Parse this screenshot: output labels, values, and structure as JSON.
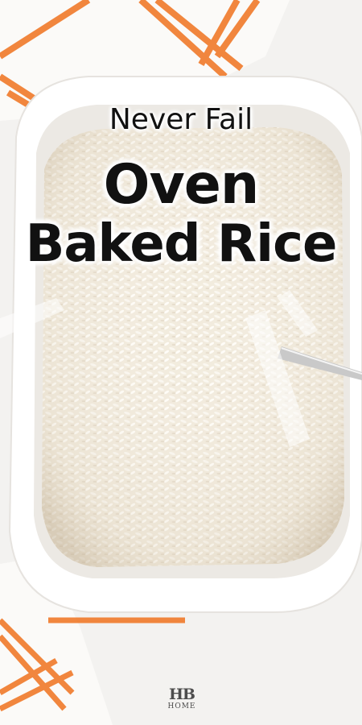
{
  "title": {
    "line1": "Never Fail",
    "line2": "Oven",
    "line3": "Baked Rice"
  },
  "logo": {
    "monogram": "HB",
    "word": "HOME"
  },
  "colors": {
    "towel_stripe": "#f07a2a",
    "towel_base": "#fbfaf8",
    "dish": "#ffffff",
    "rice": "#f3ecdf",
    "text": "#111111"
  }
}
